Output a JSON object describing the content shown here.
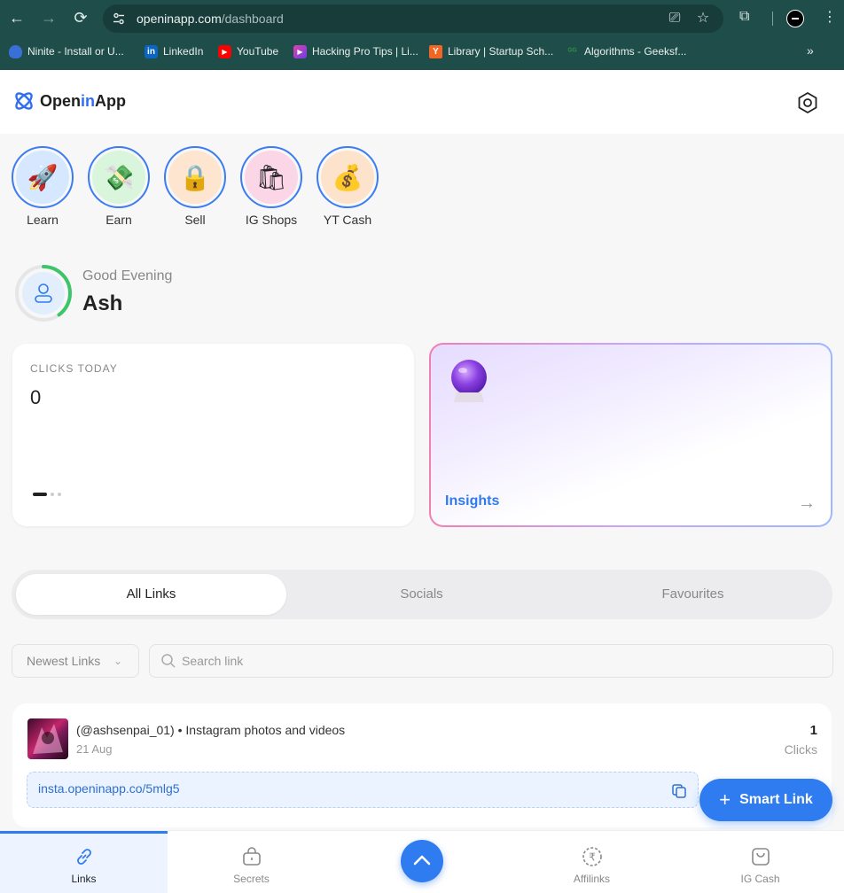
{
  "browser": {
    "url_host": "openinapp.com",
    "url_path": "/dashboard",
    "bookmarks": [
      {
        "label": "Ninite - Install or U...",
        "icon": "ninite-icon",
        "color": "#3a6fd8"
      },
      {
        "label": "LinkedIn",
        "icon": "linkedin-icon",
        "color": "#0a66c2"
      },
      {
        "label": "YouTube",
        "icon": "youtube-icon",
        "color": "#ff0000"
      },
      {
        "label": "Hacking Pro Tips | Li...",
        "icon": "hacking-icon",
        "color": "#7b3fe4"
      },
      {
        "label": "Library | Startup Sch...",
        "icon": "ycombinator-icon",
        "color": "#f26522"
      },
      {
        "label": "Algorithms - Geeksf...",
        "icon": "geeksforgeeks-icon",
        "color": "#2f8d46"
      }
    ]
  },
  "header": {
    "logo_pre": "Open",
    "logo_mid": "in",
    "logo_post": "App"
  },
  "stories": [
    {
      "label": "Learn",
      "icon": "rocket-icon",
      "bg": "#d6e8ff",
      "glyph": "🚀"
    },
    {
      "label": "Earn",
      "icon": "money-icon",
      "bg": "#d9f5dc",
      "glyph": "💸"
    },
    {
      "label": "Sell",
      "icon": "lock-icon",
      "bg": "#fde5cf",
      "glyph": "🔒"
    },
    {
      "label": "IG Shops",
      "icon": "shopping-bag-icon",
      "bg": "#fbd6e6",
      "glyph": "🛍"
    },
    {
      "label": "YT Cash",
      "icon": "money-bag-icon",
      "bg": "#fde2cc",
      "glyph": "💰"
    }
  ],
  "greeting": {
    "salutation": "Good Evening",
    "name": "Ash",
    "progress": 0.4
  },
  "clicks_card": {
    "title": "CLICKS TODAY",
    "value": "0"
  },
  "insights_card": {
    "label": "Insights"
  },
  "tabs": [
    {
      "label": "All Links",
      "active": true
    },
    {
      "label": "Socials",
      "active": false
    },
    {
      "label": "Favourites",
      "active": false
    }
  ],
  "filters": {
    "sort_label": "Newest Links",
    "search_placeholder": "Search link"
  },
  "link": {
    "title": "(@ashsenpai_01) • Instagram photos and videos",
    "date": "21 Aug",
    "clicks": "1",
    "clicks_label": "Clicks",
    "short_url": "insta.openinapp.co/5mlg5"
  },
  "smart_link_label": "Smart Link",
  "bottom_nav": [
    {
      "label": "Links",
      "icon": "link-icon",
      "active": true
    },
    {
      "label": "Secrets",
      "icon": "lock-bag-icon",
      "active": false
    },
    {
      "label": "Affilinks",
      "icon": "rupee-icon",
      "active": false
    },
    {
      "label": "IG Cash",
      "icon": "shopping-bag-icon",
      "active": false
    }
  ],
  "colors": {
    "accent": "#2f7bf0",
    "chrome": "#1f4d4a",
    "progress_ring": "#3cc56a"
  }
}
